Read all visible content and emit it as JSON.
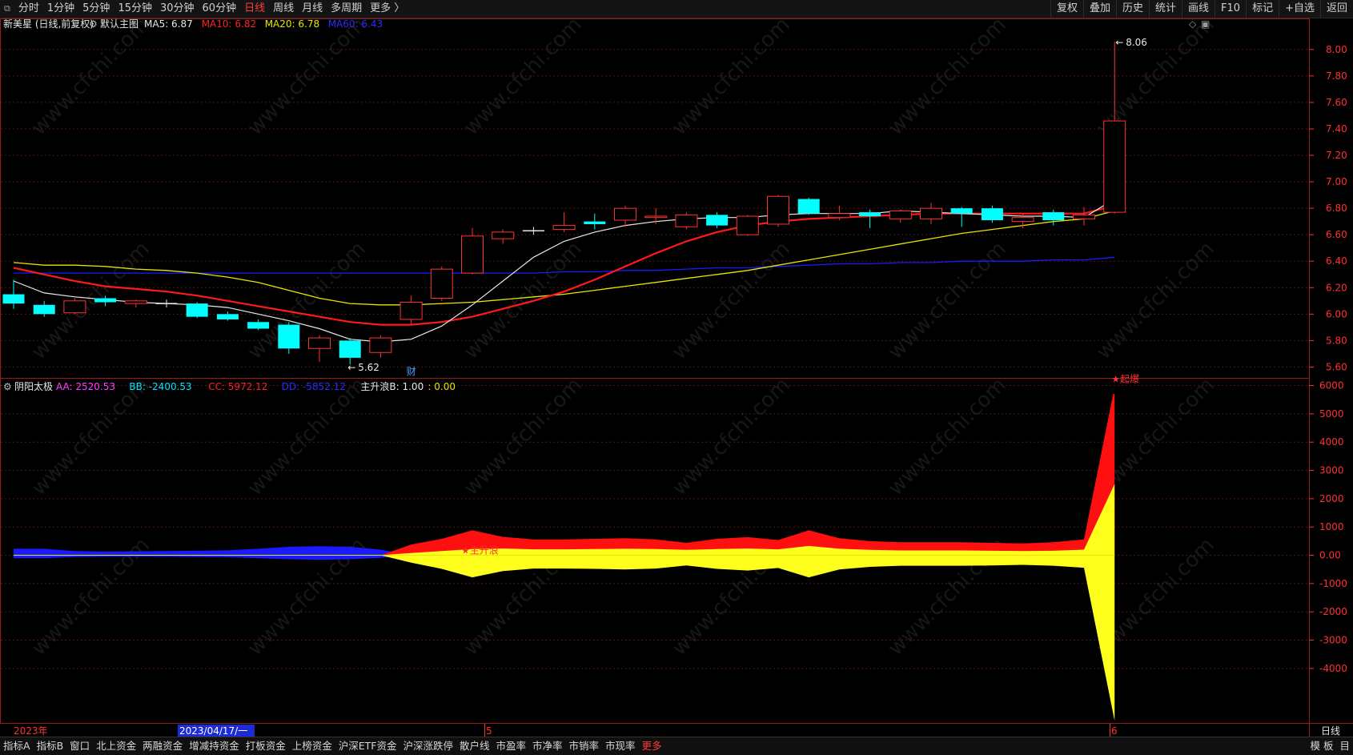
{
  "toolbar": {
    "periods": [
      "分时",
      "1分钟",
      "5分钟",
      "15分钟",
      "30分钟",
      "60分钟",
      "日线",
      "周线",
      "月线",
      "多周期",
      "更多 〉"
    ],
    "active_period": "日线",
    "right_buttons": [
      "复权",
      "叠加",
      "历史",
      "统计",
      "画线",
      "F10",
      "标记",
      "+自选",
      "返回"
    ]
  },
  "main_panel": {
    "stock_title": "新美星 (日线,前复权)",
    "template_label": "默认主图",
    "ma_labels": [
      {
        "text": "MA5: 6.87",
        "color": "#e8e8e8"
      },
      {
        "text": "MA10: 6.82",
        "color": "#ff2020"
      },
      {
        "text": "MA20: 6.78",
        "color": "#e6e600"
      },
      {
        "text": "MA60: 6.43",
        "color": "#2b2bff"
      }
    ],
    "high_label": "8.06",
    "low_label": "5.62",
    "event_marker": "财",
    "price_axis": {
      "ticks": [
        "8.00",
        "7.80",
        "7.60",
        "7.40",
        "7.20",
        "7.00",
        "6.80",
        "6.60",
        "6.40",
        "6.20",
        "6.00",
        "5.80",
        "5.60"
      ],
      "min": 5.53,
      "max": 8.12
    },
    "candles": [
      {
        "o": 6.15,
        "h": 6.26,
        "l": 6.04,
        "c": 6.08
      },
      {
        "o": 6.07,
        "h": 6.1,
        "l": 5.98,
        "c": 6.0
      },
      {
        "o": 6.01,
        "h": 6.12,
        "l": 6.0,
        "c": 6.1
      },
      {
        "o": 6.12,
        "h": 6.14,
        "l": 6.06,
        "c": 6.09
      },
      {
        "o": 6.08,
        "h": 6.11,
        "l": 6.05,
        "c": 6.1
      },
      {
        "o": 6.08,
        "h": 6.11,
        "l": 6.05,
        "c": 6.08
      },
      {
        "o": 6.08,
        "h": 6.09,
        "l": 5.97,
        "c": 5.98
      },
      {
        "o": 6.0,
        "h": 6.02,
        "l": 5.95,
        "c": 5.96
      },
      {
        "o": 5.94,
        "h": 5.96,
        "l": 5.88,
        "c": 5.89
      },
      {
        "o": 5.92,
        "h": 5.94,
        "l": 5.7,
        "c": 5.74
      },
      {
        "o": 5.74,
        "h": 5.84,
        "l": 5.64,
        "c": 5.82
      },
      {
        "o": 5.8,
        "h": 5.82,
        "l": 5.62,
        "c": 5.67
      },
      {
        "o": 5.71,
        "h": 5.84,
        "l": 5.67,
        "c": 5.82
      },
      {
        "o": 5.96,
        "h": 6.14,
        "l": 5.92,
        "c": 6.09
      },
      {
        "o": 6.12,
        "h": 6.36,
        "l": 6.1,
        "c": 6.34
      },
      {
        "o": 6.31,
        "h": 6.65,
        "l": 6.3,
        "c": 6.59
      },
      {
        "o": 6.57,
        "h": 6.64,
        "l": 6.53,
        "c": 6.62
      },
      {
        "o": 6.63,
        "h": 6.66,
        "l": 6.6,
        "c": 6.63
      },
      {
        "o": 6.64,
        "h": 6.77,
        "l": 6.62,
        "c": 6.67
      },
      {
        "o": 6.7,
        "h": 6.76,
        "l": 6.64,
        "c": 6.68
      },
      {
        "o": 6.71,
        "h": 6.82,
        "l": 6.66,
        "c": 6.8
      },
      {
        "o": 6.73,
        "h": 6.8,
        "l": 6.68,
        "c": 6.74
      },
      {
        "o": 6.66,
        "h": 6.77,
        "l": 6.64,
        "c": 6.75
      },
      {
        "o": 6.75,
        "h": 6.77,
        "l": 6.65,
        "c": 6.67
      },
      {
        "o": 6.6,
        "h": 6.75,
        "l": 6.59,
        "c": 6.74
      },
      {
        "o": 6.68,
        "h": 6.9,
        "l": 6.66,
        "c": 6.89
      },
      {
        "o": 6.87,
        "h": 6.88,
        "l": 6.75,
        "c": 6.76
      },
      {
        "o": 6.73,
        "h": 6.82,
        "l": 6.71,
        "c": 6.76
      },
      {
        "o": 6.77,
        "h": 6.79,
        "l": 6.65,
        "c": 6.74
      },
      {
        "o": 6.72,
        "h": 6.79,
        "l": 6.69,
        "c": 6.78
      },
      {
        "o": 6.72,
        "h": 6.84,
        "l": 6.68,
        "c": 6.8
      },
      {
        "o": 6.8,
        "h": 6.81,
        "l": 6.66,
        "c": 6.76
      },
      {
        "o": 6.8,
        "h": 6.82,
        "l": 6.69,
        "c": 6.71
      },
      {
        "o": 6.7,
        "h": 6.76,
        "l": 6.65,
        "c": 6.73
      },
      {
        "o": 6.77,
        "h": 6.79,
        "l": 6.67,
        "c": 6.71
      },
      {
        "o": 6.72,
        "h": 6.81,
        "l": 6.67,
        "c": 6.75
      },
      {
        "o": 6.77,
        "h": 8.06,
        "l": 6.76,
        "c": 7.46
      }
    ],
    "ma5": [
      6.25,
      6.16,
      6.13,
      6.11,
      6.09,
      6.08,
      6.07,
      6.05,
      6.0,
      5.95,
      5.89,
      5.81,
      5.79,
      5.81,
      5.91,
      6.07,
      6.25,
      6.43,
      6.55,
      6.62,
      6.67,
      6.7,
      6.72,
      6.73,
      6.73,
      6.75,
      6.76,
      6.76,
      6.76,
      6.78,
      6.77,
      6.76,
      6.75,
      6.74,
      6.74,
      6.73,
      6.87
    ],
    "ma10": [
      6.35,
      6.3,
      6.25,
      6.21,
      6.19,
      6.17,
      6.14,
      6.1,
      6.06,
      6.02,
      5.98,
      5.94,
      5.92,
      5.92,
      5.94,
      5.98,
      6.04,
      6.1,
      6.17,
      6.26,
      6.36,
      6.46,
      6.55,
      6.62,
      6.67,
      6.7,
      6.72,
      6.73,
      6.74,
      6.75,
      6.76,
      6.76,
      6.76,
      6.76,
      6.76,
      6.76,
      6.82
    ],
    "ma20": [
      6.39,
      6.37,
      6.37,
      6.36,
      6.34,
      6.33,
      6.31,
      6.28,
      6.24,
      6.18,
      6.12,
      6.08,
      6.07,
      6.07,
      6.08,
      6.09,
      6.11,
      6.13,
      6.15,
      6.18,
      6.21,
      6.24,
      6.27,
      6.3,
      6.33,
      6.37,
      6.41,
      6.45,
      6.49,
      6.53,
      6.57,
      6.61,
      6.64,
      6.67,
      6.7,
      6.72,
      6.78
    ],
    "ma60": [
      6.31,
      6.31,
      6.31,
      6.31,
      6.31,
      6.31,
      6.31,
      6.31,
      6.31,
      6.31,
      6.31,
      6.31,
      6.31,
      6.31,
      6.31,
      6.31,
      6.31,
      6.31,
      6.32,
      6.32,
      6.33,
      6.33,
      6.34,
      6.35,
      6.35,
      6.36,
      6.37,
      6.38,
      6.38,
      6.39,
      6.39,
      6.4,
      6.4,
      6.4,
      6.41,
      6.41,
      6.43
    ]
  },
  "indicator_panel": {
    "name": "阴阳太极",
    "values": [
      {
        "text": "AA: 2520.53",
        "color": "#ff40ff"
      },
      {
        "text": "BB: -2400.53",
        "color": "#00e5ff"
      },
      {
        "text": "CC: 5972.12",
        "color": "#ff2020"
      },
      {
        "text": "DD: -5852.12",
        "color": "#2b2bff"
      },
      {
        "text": "主升浪B: 1.00",
        "color": "#e8e8e8"
      },
      {
        "text": ": 0.00",
        "color": "#e6e600"
      }
    ],
    "zhusheng_label": "★主升浪",
    "peak_label": "★起爆",
    "axis": {
      "ticks": [
        "6000",
        "5000",
        "4000",
        "3000",
        "2000",
        "1000",
        "0.00",
        "-1000",
        "-2000",
        "-3000",
        "-4000"
      ],
      "min": -5900,
      "max": 6100
    },
    "red_upper": [
      0,
      0,
      0,
      0,
      0,
      0,
      0,
      0,
      0,
      0,
      0,
      0,
      0,
      380,
      580,
      880,
      650,
      560,
      560,
      580,
      600,
      560,
      440,
      580,
      640,
      540,
      880,
      600,
      500,
      460,
      460,
      460,
      440,
      420,
      460,
      560,
      5950
    ],
    "yellow_upper": [
      0,
      0,
      0,
      0,
      0,
      0,
      0,
      0,
      0,
      0,
      0,
      0,
      0,
      80,
      150,
      220,
      240,
      210,
      210,
      220,
      230,
      220,
      190,
      220,
      240,
      210,
      330,
      230,
      190,
      170,
      170,
      170,
      160,
      150,
      160,
      200,
      2520
    ],
    "yellow_lower": [
      0,
      0,
      0,
      0,
      0,
      0,
      0,
      0,
      0,
      0,
      0,
      0,
      0,
      -260,
      -480,
      -780,
      -560,
      -470,
      -470,
      -480,
      -500,
      -470,
      -360,
      -480,
      -540,
      -450,
      -780,
      -500,
      -410,
      -370,
      -370,
      -370,
      -360,
      -340,
      -370,
      -440,
      -5850
    ],
    "blue_upper": [
      230,
      230,
      150,
      130,
      140,
      150,
      160,
      180,
      230,
      300,
      320,
      300,
      200,
      0,
      0,
      0,
      0,
      0,
      0,
      0,
      0,
      0,
      0,
      0,
      0,
      0,
      0,
      0,
      0,
      0,
      0,
      0,
      0,
      0,
      0,
      0,
      0
    ],
    "blue_lower": [
      -100,
      -100,
      -60,
      -50,
      -50,
      -50,
      -60,
      -70,
      -100,
      -140,
      -160,
      -140,
      -90,
      0,
      0,
      0,
      0,
      0,
      0,
      0,
      0,
      0,
      0,
      0,
      0,
      0,
      0,
      0,
      0,
      0,
      0,
      0,
      0,
      0,
      0,
      0,
      0
    ]
  },
  "time_axis": {
    "year_label": "2023年",
    "cursor_date": "2023/04/17/一",
    "month_labels": [
      "5",
      "6"
    ],
    "period_label": "日线"
  },
  "bottom_tabs": [
    "指标A",
    "指标B",
    "窗口",
    "北上资金",
    "两融资金",
    "增减持资金",
    "打板资金",
    "上榜资金",
    "沪深ETF资金",
    "沪深涨跌停",
    "散户线",
    "市盈率",
    "市净率",
    "市销率",
    "市现率",
    "更多"
  ],
  "bottom_right": [
    "模 板",
    "目"
  ],
  "watermark": "www.cfchi.com",
  "colors": {
    "up": "#ff3232",
    "down": "#00ffff",
    "axis": "#ff3030",
    "grid": "#5a1515",
    "border": "#9a1a1a"
  }
}
